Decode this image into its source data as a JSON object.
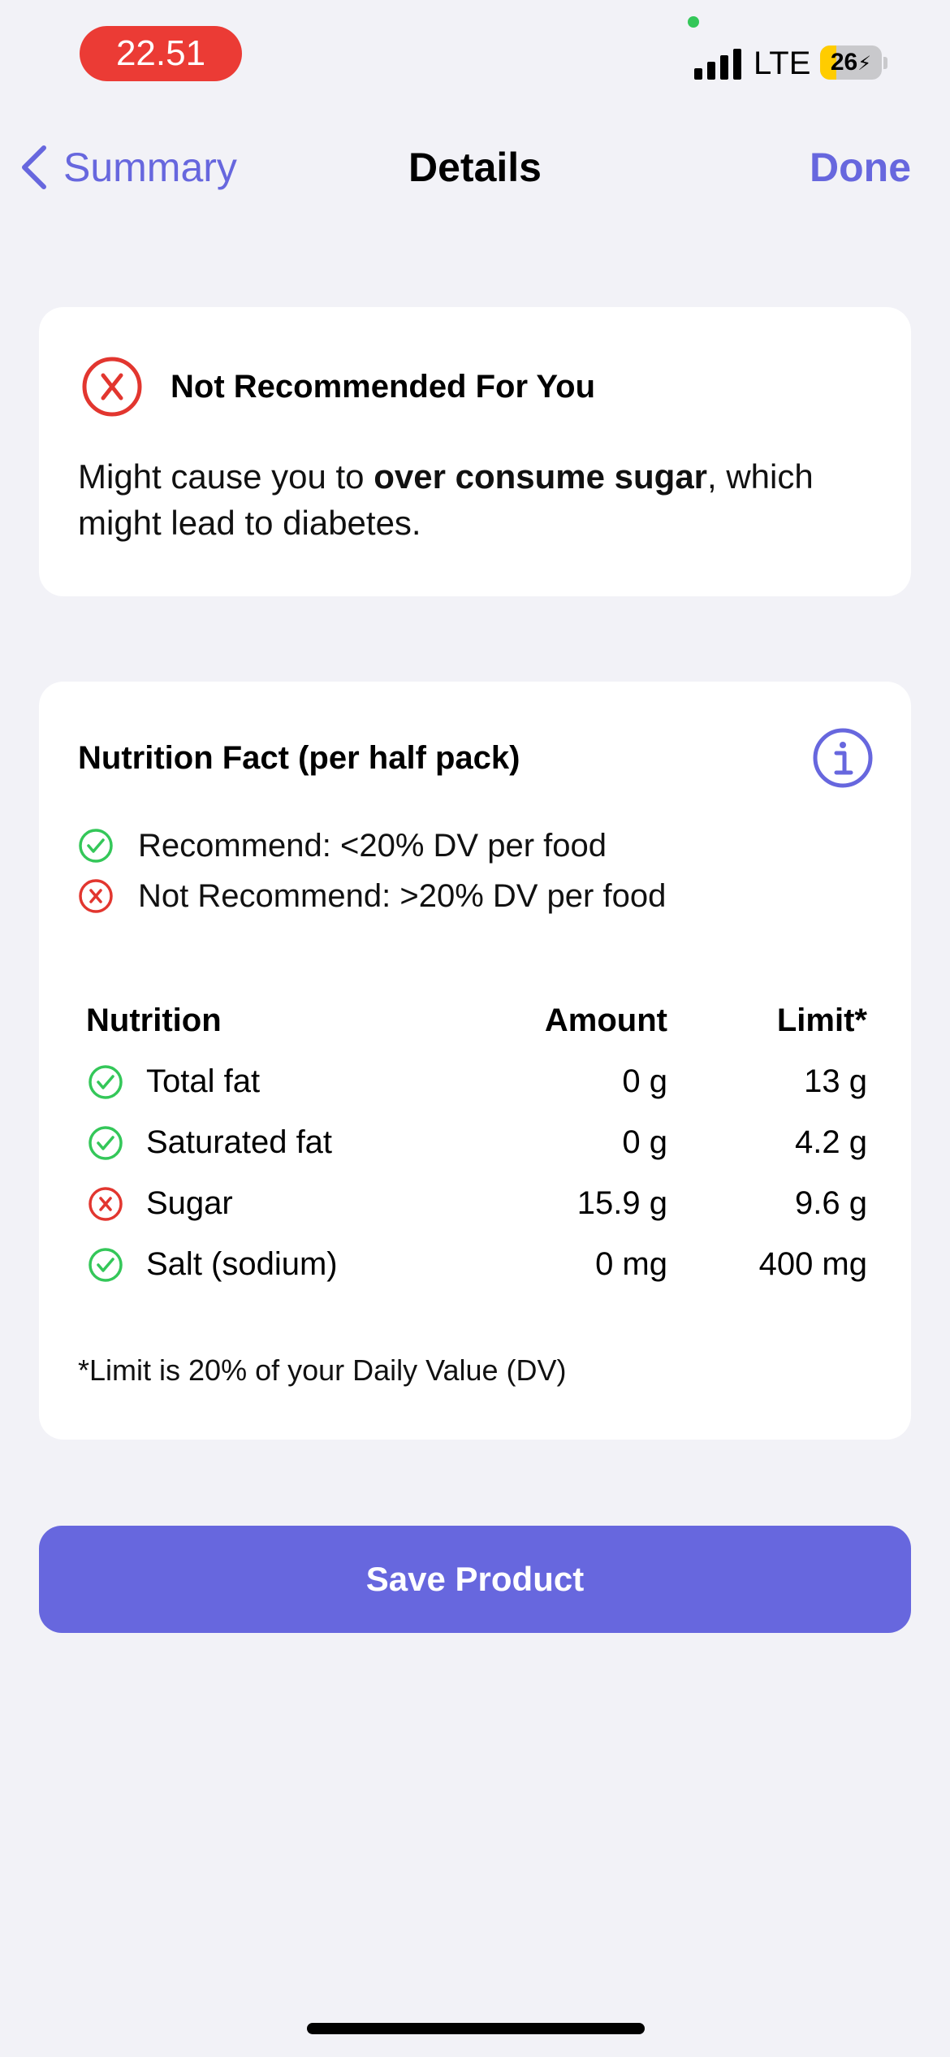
{
  "status_bar": {
    "time": "22.51",
    "network": "LTE",
    "battery": "26",
    "battery_level_percent": 26
  },
  "nav": {
    "back_label": "Summary",
    "title": "Details",
    "done_label": "Done"
  },
  "warning": {
    "title": "Not Recommended For You",
    "message_prefix": "Might cause you to ",
    "message_bold": "over consume sugar",
    "message_suffix": ", which might lead to diabetes.",
    "icon": "x-circle-icon"
  },
  "nutrition": {
    "title": "Nutrition Fact (per half pack)",
    "info_icon": "info-icon",
    "legend": [
      {
        "status": "ok",
        "text": "Recommend: <20% DV per food"
      },
      {
        "status": "bad",
        "text": "Not Recommend: >20% DV per food"
      }
    ],
    "headers": {
      "name": "Nutrition",
      "amount": "Amount",
      "limit": "Limit*"
    },
    "rows": [
      {
        "status": "ok",
        "name": "Total fat",
        "amount": "0 g",
        "limit": "13 g"
      },
      {
        "status": "ok",
        "name": "Saturated fat",
        "amount": "0 g",
        "limit": "4.2 g"
      },
      {
        "status": "bad",
        "name": "Sugar",
        "amount": "15.9 g",
        "limit": "9.6 g"
      },
      {
        "status": "ok",
        "name": "Salt (sodium)",
        "amount": "0 mg",
        "limit": "400 mg"
      }
    ],
    "footnote": "*Limit is 20% of your Daily Value (DV)"
  },
  "save_button": {
    "label": "Save Product"
  },
  "colors": {
    "accent": "#6767de",
    "danger": "#e2362f",
    "ok": "#34c759",
    "background": "#f2f2f7",
    "time_pill": "#eb3b35",
    "battery_fill": "#ffcc00"
  }
}
